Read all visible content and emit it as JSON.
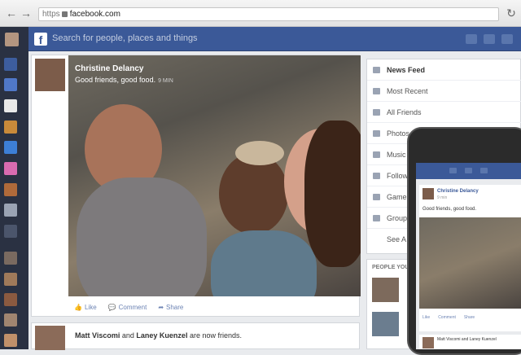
{
  "browser": {
    "url_scheme": "https",
    "url_host": "facebook.com",
    "back_icon": "back-arrow-icon",
    "forward_icon": "forward-arrow-icon",
    "reload_icon": "reload-icon"
  },
  "header": {
    "logo": "f",
    "search_placeholder": "Search for people, places and things"
  },
  "post": {
    "author": "Christine Delancy",
    "status": "Good friends, good food.",
    "time": "9 MIN",
    "actions": [
      "Like",
      "Comment",
      "Share"
    ]
  },
  "post2": {
    "friend_a": "Matt Viscomi",
    "conj": "and",
    "friend_b": "Laney Kuenzel",
    "suffix": "are now friends."
  },
  "nav": {
    "items": [
      "News Feed",
      "Most Recent",
      "All Friends",
      "Photos",
      "Music",
      "Follow",
      "Games",
      "Group",
      "See A"
    ]
  },
  "people": {
    "title": "PEOPLE YOU"
  },
  "phone": {
    "author": "Christine Delancy",
    "time": "9 min",
    "status": "Good friends, good food.",
    "actions": [
      "Like",
      "Comment",
      "Share"
    ],
    "friends_line": "Matt Viscomi and Laney Kuenzel"
  },
  "colors": {
    "facebook_blue": "#3b5998",
    "rail": "#2a3142"
  }
}
